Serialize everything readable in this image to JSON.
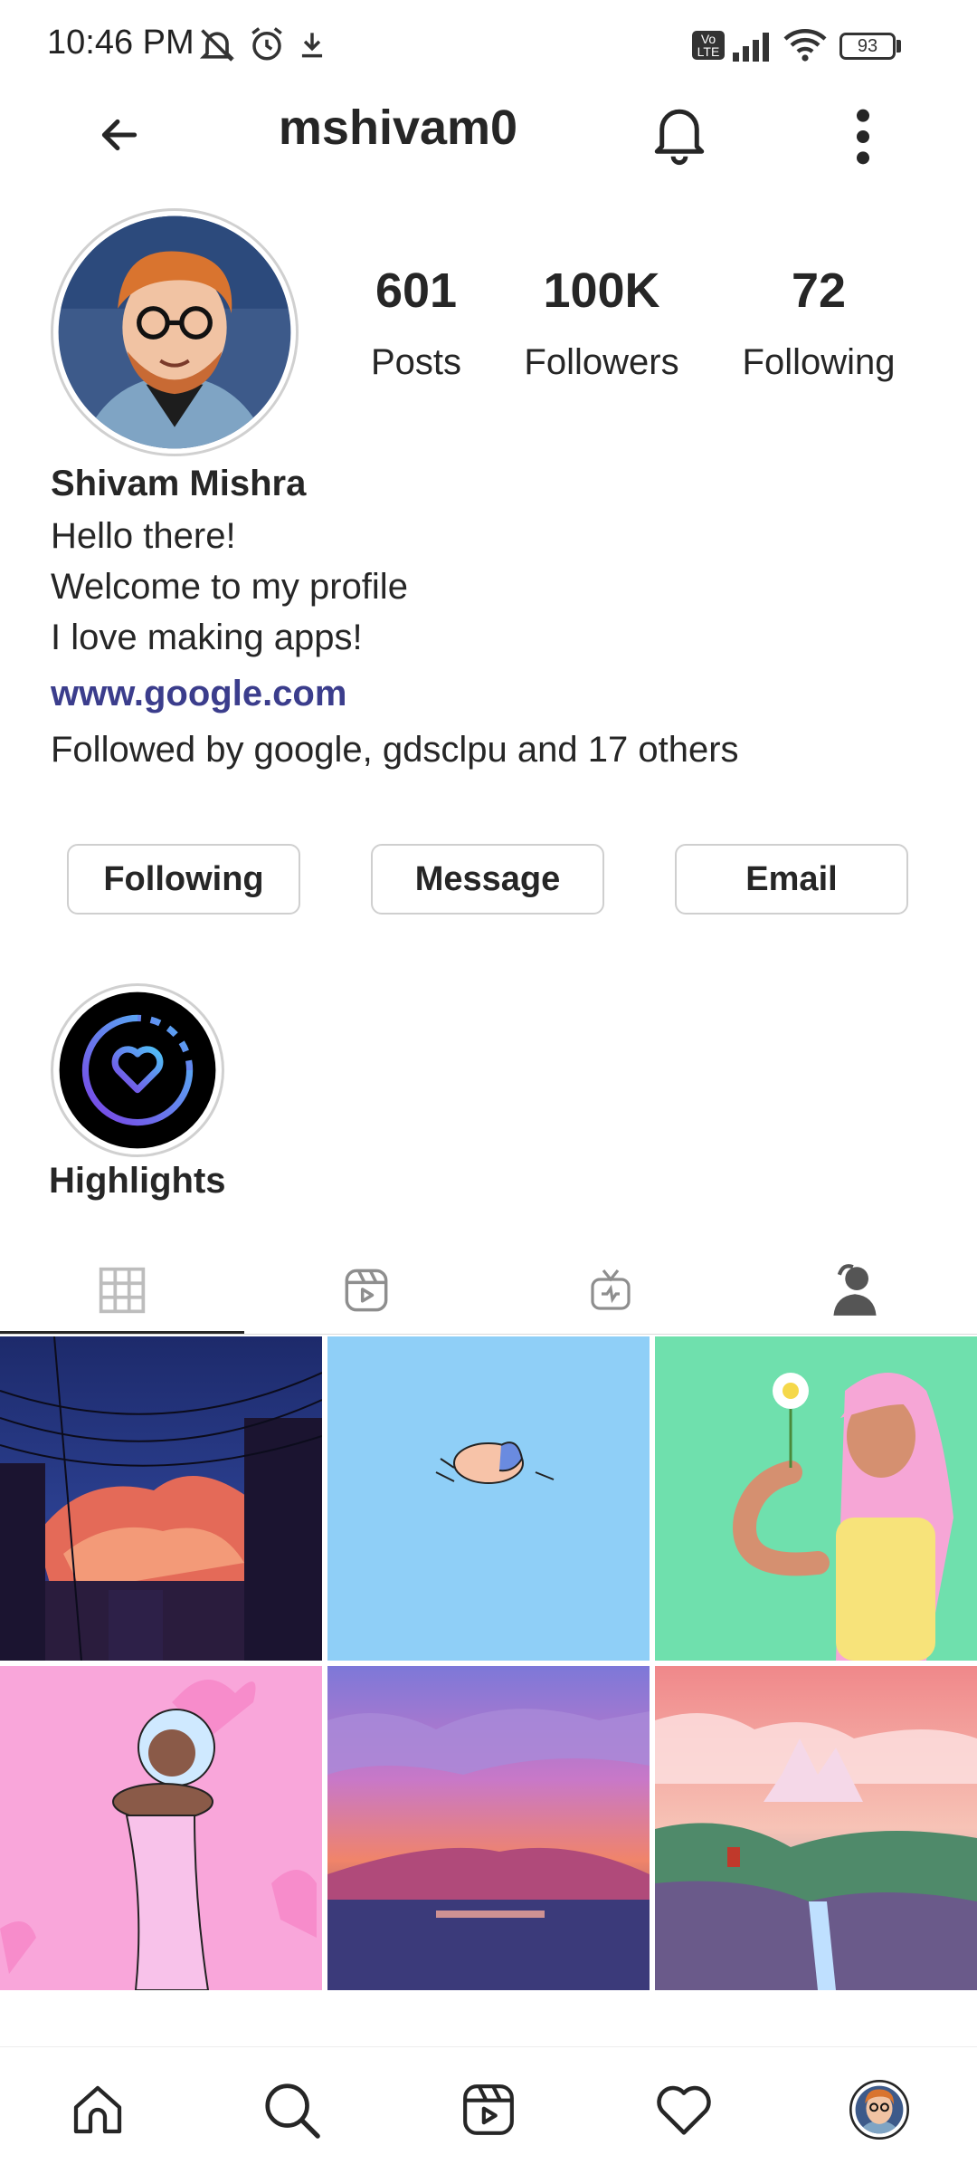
{
  "status_bar": {
    "time": "10:46 PM",
    "battery": "93"
  },
  "header": {
    "username": "mshivam0"
  },
  "stats": [
    {
      "value": "601",
      "label": "Posts"
    },
    {
      "value": "100K",
      "label": "Followers"
    },
    {
      "value": "72",
      "label": "Following"
    }
  ],
  "bio": {
    "name": "Shivam Mishra",
    "lines": [
      "Hello there!",
      "Welcome to my profile",
      "I love making apps!"
    ],
    "link": "www.google.com",
    "followed_by": "Followed by google, gdsclpu and 17 others"
  },
  "actions": {
    "following": "Following",
    "message": "Message",
    "email": "Email"
  },
  "highlights": {
    "label": "Highlights"
  },
  "colors": {
    "link": "#3b3d8c",
    "text": "#262626",
    "border": "#cfcfcf"
  }
}
